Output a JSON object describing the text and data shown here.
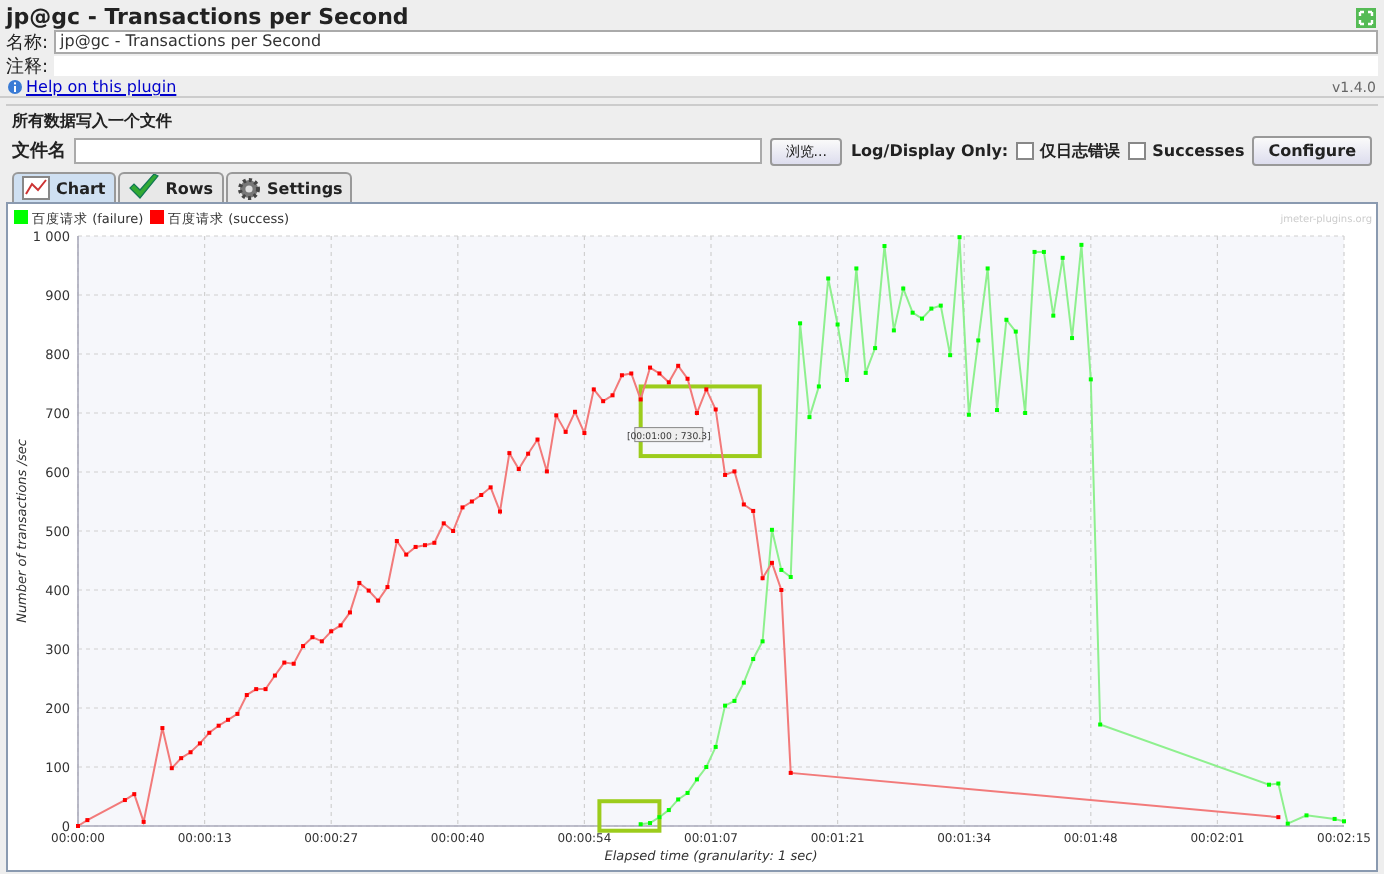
{
  "window": {
    "title": "jp@gc - Transactions per Second"
  },
  "name_field": {
    "label": "名称:",
    "value": "jp@gc - Transactions per Second"
  },
  "comment_field": {
    "label": "注释:"
  },
  "help_link": "Help on this plugin",
  "version": "v1.4.0",
  "file_group": {
    "title": "所有数据写入一个文件",
    "file_label": "文件名",
    "browse_button": "浏览...",
    "log_label": "Log/Display Only:",
    "checkboxes": [
      {
        "label": "仅日志错误",
        "checked": false
      },
      {
        "label": "Successes",
        "checked": false
      }
    ],
    "configure_button": "Configure"
  },
  "tabs": [
    {
      "label": "Chart",
      "selected": true
    },
    {
      "label": "Rows",
      "selected": false
    },
    {
      "label": "Settings",
      "selected": false
    }
  ],
  "chart_credit": "jmeter-plugins.org",
  "chart_data": {
    "type": "line",
    "xlabel": "Elapsed time (granularity: 1 sec)",
    "ylabel": "Number of transactions /sec",
    "grid": true,
    "legend": true,
    "x": [
      0,
      1,
      5,
      6,
      7,
      9,
      10,
      11,
      12,
      13,
      14,
      15,
      16,
      17,
      18,
      19,
      20,
      21,
      22,
      23,
      24,
      25,
      26,
      27,
      28,
      29,
      30,
      31,
      32,
      33,
      34,
      35,
      36,
      37,
      38,
      39,
      40,
      41,
      42,
      43,
      44,
      45,
      46,
      47,
      48,
      49,
      50,
      51,
      52,
      53,
      54,
      55,
      56,
      57,
      58,
      59,
      60,
      61,
      62,
      63,
      64,
      65,
      66,
      67,
      68,
      69,
      70,
      71,
      72,
      73,
      74,
      75,
      76,
      77,
      78,
      79,
      80,
      81,
      82,
      83,
      84,
      85,
      86,
      87,
      88,
      89,
      90,
      91,
      92,
      93,
      94,
      95,
      96,
      97,
      98,
      99,
      100,
      101,
      102,
      103,
      104,
      105,
      106,
      107,
      108,
      109,
      127,
      128,
      129,
      131,
      134,
      135
    ],
    "series": [
      {
        "name": "百度请求 (failure)",
        "color": "#00ff00",
        "marker": "square",
        "values": [
          null,
          null,
          null,
          null,
          null,
          null,
          null,
          null,
          null,
          null,
          null,
          null,
          null,
          null,
          null,
          null,
          null,
          null,
          null,
          null,
          null,
          null,
          null,
          null,
          null,
          null,
          null,
          null,
          null,
          null,
          null,
          null,
          null,
          null,
          null,
          null,
          null,
          null,
          null,
          null,
          null,
          null,
          null,
          null,
          null,
          null,
          null,
          null,
          null,
          null,
          null,
          null,
          null,
          null,
          null,
          null,
          3,
          5,
          15,
          27,
          45,
          56,
          79,
          100,
          134,
          204,
          212,
          243,
          283,
          313,
          502,
          434,
          422,
          852,
          693,
          745,
          928,
          850,
          756,
          945,
          768,
          810,
          983,
          840,
          911,
          870,
          860,
          877,
          882,
          798,
          998,
          697,
          823,
          945,
          705,
          858,
          838,
          700,
          973,
          973,
          865,
          963,
          827,
          985,
          757,
          172,
          70,
          72,
          4,
          18,
          12,
          8
        ]
      },
      {
        "name": "百度请求 (success)",
        "color": "#ff0000",
        "marker": "square",
        "values": [
          0,
          10,
          44,
          54,
          7,
          166,
          98,
          115,
          125,
          140,
          158,
          170,
          180,
          190,
          222,
          232,
          232,
          255,
          277,
          275,
          305,
          320,
          313,
          330,
          340,
          362,
          412,
          399,
          382,
          405,
          483,
          460,
          473,
          476,
          480,
          513,
          500,
          540,
          550,
          561,
          574,
          533,
          632,
          605,
          631,
          655,
          601,
          696,
          668,
          702,
          666,
          740,
          720,
          730,
          764,
          767,
          723,
          777,
          767,
          752,
          780,
          758,
          700,
          740,
          706,
          595,
          601,
          545,
          534,
          420,
          446,
          400,
          90,
          null,
          null,
          null,
          null,
          null,
          null,
          null,
          null,
          null,
          null,
          null,
          null,
          null,
          null,
          null,
          null,
          null,
          null,
          null,
          null,
          null,
          null,
          null,
          null,
          null,
          null,
          null,
          null,
          null,
          null,
          null,
          null,
          null,
          null,
          15,
          null,
          null,
          null,
          null
        ]
      }
    ],
    "xlim": [
      0,
      135
    ],
    "ylim": [
      0,
      1000
    ],
    "xticks": [
      {
        "value": 0,
        "label": "00:00:00"
      },
      {
        "value": 13.5,
        "label": "00:00:13"
      },
      {
        "value": 27,
        "label": "00:00:27"
      },
      {
        "value": 40.5,
        "label": "00:00:40"
      },
      {
        "value": 54,
        "label": "00:00:54"
      },
      {
        "value": 67.5,
        "label": "00:01:07"
      },
      {
        "value": 81,
        "label": "00:01:21"
      },
      {
        "value": 94.5,
        "label": "00:01:34"
      },
      {
        "value": 108,
        "label": "00:01:48"
      },
      {
        "value": 121.5,
        "label": "00:02:01"
      },
      {
        "value": 135,
        "label": "00:02:15"
      }
    ],
    "yticks": [
      0,
      100,
      200,
      300,
      400,
      500,
      600,
      700,
      800,
      900,
      {
        "value": 1000,
        "label": "1 000"
      }
    ],
    "annotations": [
      "[00:01:00 ; 730.3]"
    ]
  }
}
